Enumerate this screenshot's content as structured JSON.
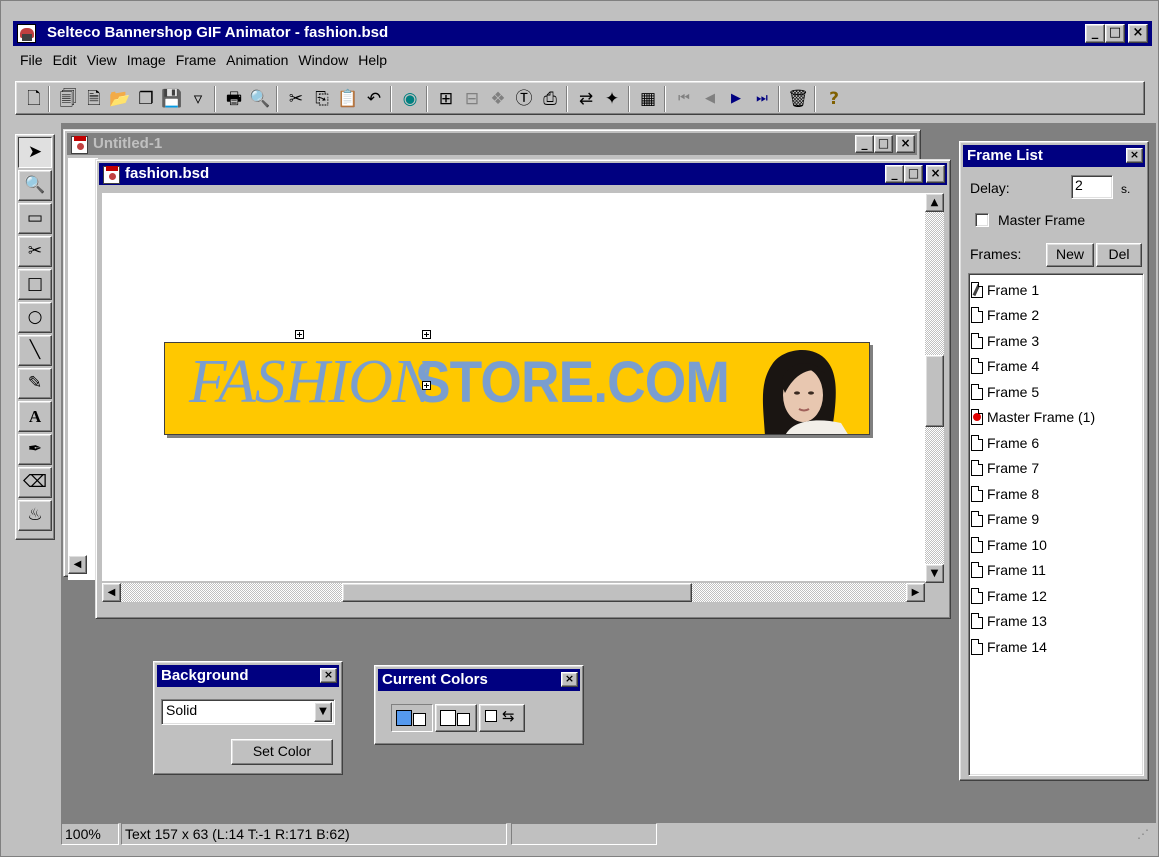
{
  "app": {
    "title": "Selteco Bannershop GIF Animator - fashion.bsd",
    "caption_buttons": [
      "_",
      "□",
      "×"
    ]
  },
  "menu": [
    "File",
    "Edit",
    "View",
    "Image",
    "Frame",
    "Animation",
    "Window",
    "Help"
  ],
  "toolbar": {
    "icons": [
      "new-icon",
      "new-wizard-icon",
      "new-from-template-icon",
      "open-icon",
      "open-multiple-icon",
      "save-icon",
      "optimize-icon",
      "print-icon",
      "print-preview-icon",
      "cut-icon",
      "copy-icon",
      "paste-icon",
      "undo-icon",
      "preview-icon",
      "fit-icon",
      "align-icon",
      "layers-icon",
      "text-effects-icon",
      "export-icon",
      "transition-icon",
      "magic-wand-icon",
      "keyframes-icon",
      "first-frame-icon",
      "previous-frame-icon",
      "play-icon",
      "last-frame-icon",
      "delete-icon",
      "help-icon"
    ]
  },
  "tools": [
    "arrow-tool-icon",
    "zoom-tool-icon",
    "select-rect-tool-icon",
    "crop-tool-icon",
    "rectangle-tool-icon",
    "ellipse-tool-icon",
    "line-tool-icon",
    "pencil-tool-icon",
    "text-tool-icon",
    "eyedropper-tool-icon",
    "eraser-tool-icon",
    "fill-tool-icon"
  ],
  "windows": {
    "untitled": {
      "title": "Untitled-1"
    },
    "fashion": {
      "title": "fashion.bsd"
    }
  },
  "banner": {
    "text_fashion": "FASHION",
    "text_store": "STORE.COM",
    "colors": {
      "background": "#ffc800",
      "text": "#7a9ecf"
    }
  },
  "framelist": {
    "title": "Frame List",
    "delay_label": "Delay:",
    "delay_value": "2",
    "delay_unit": "s.",
    "master_frame_label": "Master Frame",
    "frames_label": "Frames:",
    "new_button": "New",
    "del_button": "Del",
    "frames": [
      "Frame 1",
      "Frame 2",
      "Frame 3",
      "Frame 4",
      "Frame 5",
      "Master Frame (1)",
      "Frame 6",
      "Frame 7",
      "Frame 8",
      "Frame 9",
      "Frame 10",
      "Frame 11",
      "Frame 12",
      "Frame 13",
      "Frame 14"
    ]
  },
  "background_palette": {
    "title": "Background",
    "fill_type": "Solid",
    "set_color_button": "Set Color"
  },
  "colors_palette": {
    "title": "Current Colors",
    "foreground": "#5599ee",
    "background": "#ffffff"
  },
  "statusbar": {
    "zoom": "100%",
    "info": "Text 157 x 63 (L:14  T:-1  R:171  B:62)"
  }
}
